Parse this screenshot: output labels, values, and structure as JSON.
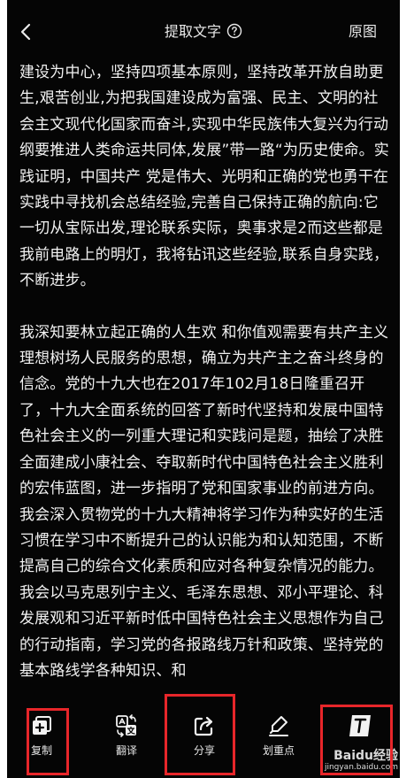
{
  "header": {
    "title": "提取文字",
    "original_label": "原图"
  },
  "content": {
    "paragraphs": [
      "建设为中心，坚持四项基本原则，坚持改革开放自助更生,艰苦创业,为把我国建设成为富强、民主、文明的社会主文现代化国家而奋斗,实现中华民族伟大复兴为行动纲要推进人类命运共同体,发展”带一路“为历史使命。实践证明，中国共产 党是伟大、光明和正确的党也勇干在实践中寻找机会总结经验,完善自己保持正确的航向:它一切从宝际出发,理论联系实际，奥事求是2而这些都是我前电路上的明灯，我将钻讯这些经验,联系自身实践，不断进步。",
      "我深知要林立起正确的人生欢 和你值观需要有共产主义理想树场人民服务的思想，确立为共产主之奋斗终身的信念。党的十九大也在2017年102月18日隆重召开了，十九大全面系统的回答了新时代坚持和发展中国特色社会主义的一列重大理记和实践问是题，抽绘了决胜全面建成小康社会、夺取新时代中国特色社会主义胜利的宏伟蓝图，进一步指明了党和国家事业的前进方向。我会深入贯物党的十九大精神将学习作为种实好的生活习惯在学习中不断提升己的认识能为和认知范围，不断提高自己的综合文化素质和应对各种复杂情况的能力。我会以马克思列宁主义、毛泽东思想、邓小平理论、科发展观和习近平新时低中国特色社会主义思想作为自己的行动指南，学习党的各报路线万针和政策、坚持党的基本路线学各种知识、和"
    ]
  },
  "toolbar": {
    "items": [
      {
        "label": "复制",
        "icon": "copy-icon"
      },
      {
        "label": "翻译",
        "icon": "translate-icon"
      },
      {
        "label": "分享",
        "icon": "share-icon"
      },
      {
        "label": "划重点",
        "icon": "highlighter-icon"
      }
    ]
  },
  "watermark": {
    "brand": "Baidu经验",
    "url": "jingyan.baidu.com"
  },
  "colors": {
    "background": "#050505",
    "text": "#f2f2f2",
    "highlight_box": "#e8262a"
  }
}
